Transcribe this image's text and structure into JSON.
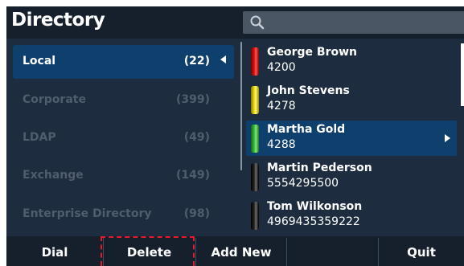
{
  "header": {
    "title": "Directory",
    "search": {
      "value": "",
      "placeholder": ""
    }
  },
  "directories": [
    {
      "name": "Local",
      "count": "(22)",
      "active": true
    },
    {
      "name": "Corporate",
      "count": "(399)",
      "active": false
    },
    {
      "name": "LDAP",
      "count": "(49)",
      "active": false
    },
    {
      "name": "Exchange",
      "count": "(149)",
      "active": false
    },
    {
      "name": "Enterprise Directory",
      "count": "(98)",
      "active": false
    }
  ],
  "contacts": [
    {
      "name": "George Brown",
      "number": "4200",
      "status_color": "#e01515"
    },
    {
      "name": "John Stevens",
      "number": "4278",
      "status_color": "#f2e30f"
    },
    {
      "name": "Martha Gold",
      "number": "4288",
      "status_color": "#3cc23c",
      "selected": true
    },
    {
      "name": "Martin Pederson",
      "number": "5554295500",
      "status_color": "#1a1a1a"
    },
    {
      "name": "Tom Wilkonson",
      "number": "4969435359222",
      "status_color": "#1a1a1a"
    }
  ],
  "softkeys": [
    "Dial",
    "Delete",
    "Add New",
    "",
    "Quit"
  ],
  "colors": {
    "background": "#1d2c3e",
    "header": "#16202c",
    "selection": "#0f3f6c",
    "annotation": "#e8192c"
  }
}
